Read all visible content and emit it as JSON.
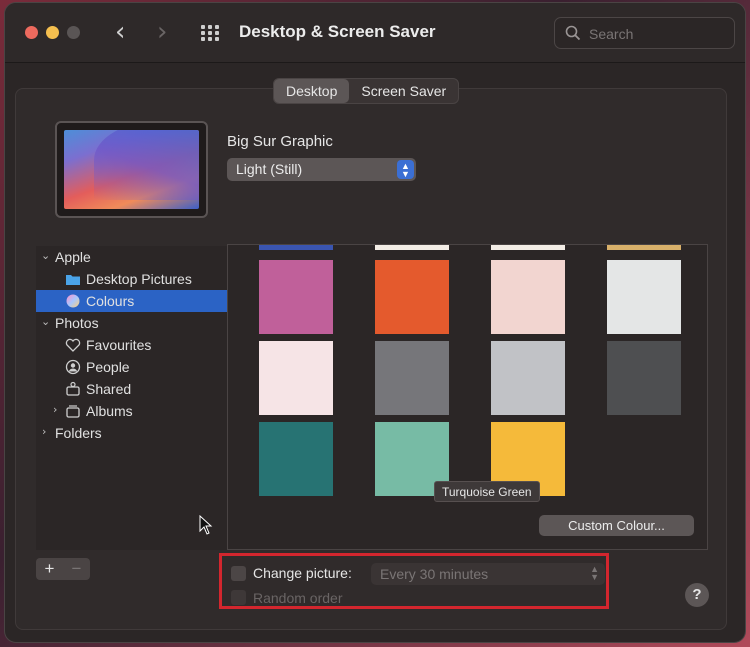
{
  "window": {
    "title": "Desktop & Screen Saver"
  },
  "search": {
    "placeholder": "Search"
  },
  "tabs": [
    {
      "label": "Desktop",
      "active": true
    },
    {
      "label": "Screen Saver",
      "active": false
    }
  ],
  "wallpaper": {
    "name": "Big Sur Graphic",
    "mode": "Light (Still)"
  },
  "sidebar": {
    "items": [
      {
        "label": "Apple",
        "icon": "chevron-down-icon",
        "level": 0
      },
      {
        "label": "Desktop Pictures",
        "icon": "folder-icon",
        "level": 1
      },
      {
        "label": "Colours",
        "icon": "colour-wheel-icon",
        "level": 1,
        "selected": true
      },
      {
        "label": "Photos",
        "icon": "chevron-down-icon",
        "level": 0
      },
      {
        "label": "Favourites",
        "icon": "heart-icon",
        "level": 1
      },
      {
        "label": "People",
        "icon": "person-icon",
        "level": 1
      },
      {
        "label": "Shared",
        "icon": "shared-album-icon",
        "level": 1
      },
      {
        "label": "Albums",
        "icon": "album-icon",
        "level": 1
      },
      {
        "label": "Folders",
        "icon": "chevron-right-icon",
        "level": 0
      }
    ]
  },
  "colours": {
    "top_strip": [
      "#3a55b0",
      "#f3ede6",
      "#f3ede6",
      "#d8b06a"
    ],
    "swatches": [
      [
        "#c0609a",
        "#e45a2d",
        "#f2d5d0",
        "#e4e6e6"
      ],
      [
        "#f6e4e6",
        "#76767a",
        "#c1c2c6",
        "#4e4f51"
      ],
      [
        "#277373",
        "#77bba5",
        "#f5ba3a"
      ]
    ],
    "tooltip": "Turquoise Green",
    "custom_button": "Custom Colour..."
  },
  "controls": {
    "add": "+",
    "remove": "−",
    "change_picture_label": "Change picture:",
    "change_picture_checked": false,
    "interval": "Every 30 minutes",
    "random_order_label": "Random order",
    "random_order_checked": false,
    "help": "?"
  },
  "colors": {
    "accent": "#2b63c5",
    "highlight_border": "#d3262e"
  }
}
